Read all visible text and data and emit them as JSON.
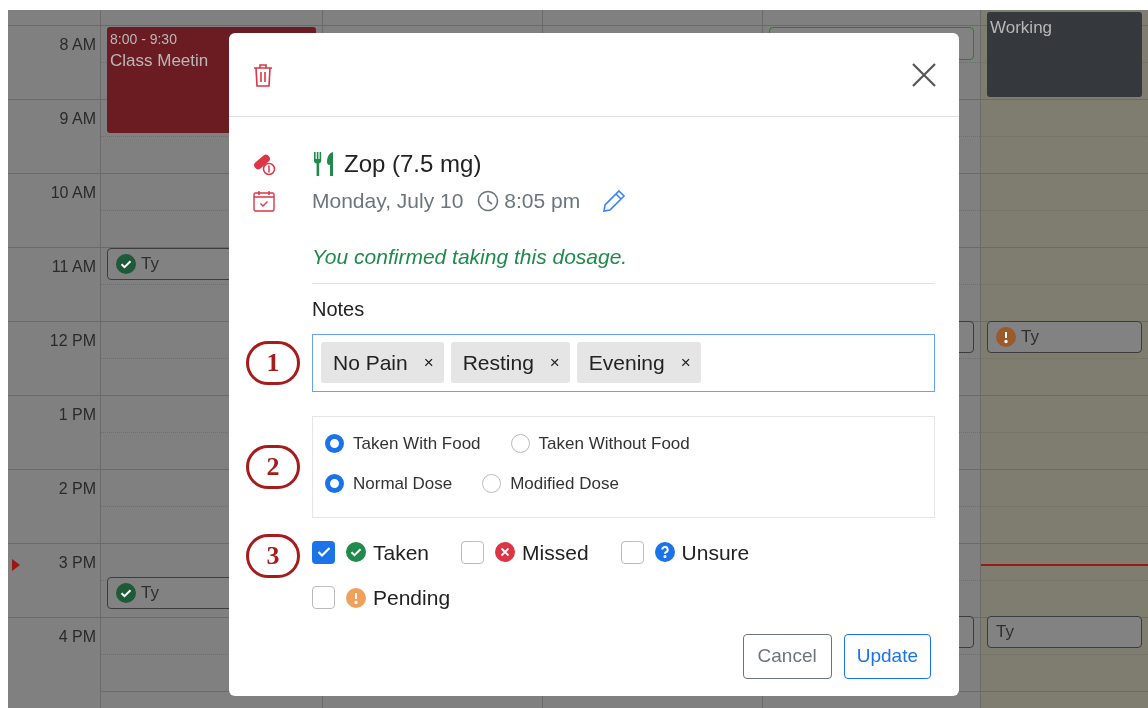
{
  "calendar": {
    "hours": [
      "8 AM",
      "9 AM",
      "10 AM",
      "11 AM",
      "12 PM",
      "1 PM",
      "2 PM",
      "3 PM",
      "4 PM"
    ],
    "days": [
      {
        "today": false,
        "events": [
          {
            "kind": "block",
            "color": "#6b1c22",
            "time": "8:00 - 9:30",
            "title": "Class Meetin"
          },
          {
            "kind": "taken",
            "title": "Ty"
          },
          {
            "kind": "taken",
            "title": "Ty"
          }
        ]
      },
      {
        "today": false
      },
      {
        "today": false
      },
      {
        "today": false,
        "events": [
          {
            "kind": "plain",
            "color": "#2e7d32"
          },
          {
            "kind": "plain"
          },
          {
            "kind": "plain"
          }
        ]
      },
      {
        "today": true,
        "events": [
          {
            "kind": "block",
            "color": "#35383d",
            "title": "Working"
          },
          {
            "kind": "pending",
            "title": "Ty"
          },
          {
            "kind": "plain",
            "title": "Ty"
          }
        ]
      }
    ]
  },
  "dialog": {
    "medication": "Zop (7.5 mg)",
    "date": "Monday, July 10",
    "time": "8:05 pm",
    "confirmation": "You confirmed taking this dosage.",
    "notes_label": "Notes",
    "tags": [
      "No Pain",
      "Resting",
      "Evening"
    ],
    "tag_remove": "×",
    "radio_groups": [
      {
        "options": [
          {
            "label": "Taken With Food",
            "selected": true
          },
          {
            "label": "Taken Without Food",
            "selected": false
          }
        ]
      },
      {
        "options": [
          {
            "label": "Normal Dose",
            "selected": true
          },
          {
            "label": "Modified Dose",
            "selected": false
          }
        ]
      }
    ],
    "statuses": [
      {
        "kind": "taken",
        "label": "Taken",
        "checked": true
      },
      {
        "kind": "missed",
        "label": "Missed",
        "checked": false
      },
      {
        "kind": "unsure",
        "label": "Unsure",
        "checked": false
      },
      {
        "kind": "pending",
        "label": "Pending",
        "checked": false
      }
    ],
    "buttons": {
      "cancel": "Cancel",
      "update": "Update"
    }
  },
  "callouts": [
    "1",
    "2",
    "3"
  ]
}
